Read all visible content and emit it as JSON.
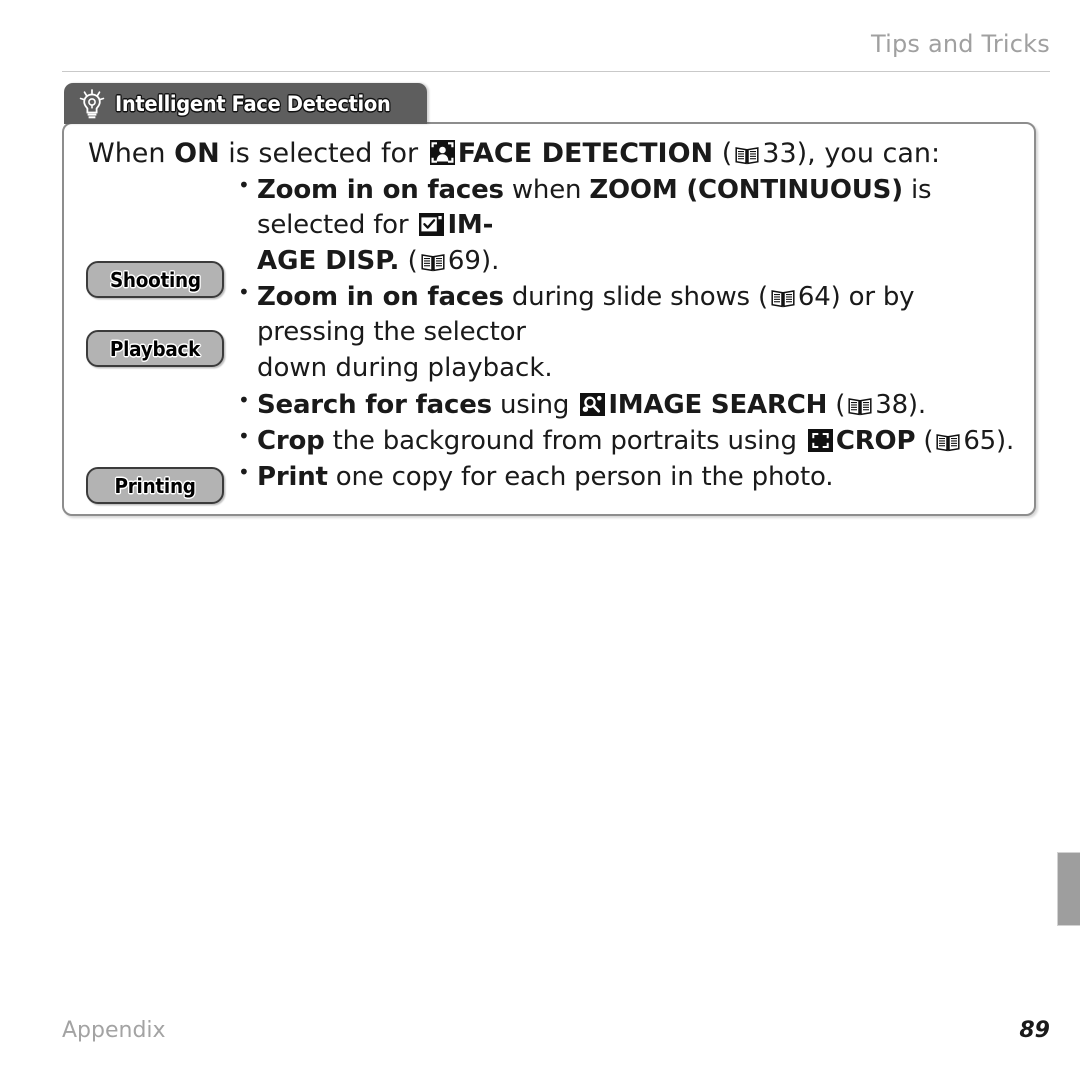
{
  "header": {
    "title": "Tips and Tricks"
  },
  "tip_box": {
    "tab_label": "Intelligent Face Detection",
    "tab_icon": "lightbulb-icon",
    "lead": {
      "part1": "When ",
      "on": "ON",
      "part2": " is selected for ",
      "icon": "face-detection-icon",
      "feature": "FACE DETECTION",
      "paren_open": " (",
      "page_icon": "book-page-ref-icon",
      "page": "33",
      "part3": "), you can:"
    },
    "badges": [
      {
        "label": "Shooting"
      },
      {
        "label": "Playback"
      },
      {
        "label": "Printing"
      }
    ],
    "bullets": [
      {
        "id": "zoom-continuous",
        "lead_bold": "Zoom in on faces",
        "mid1": " when ",
        "bold2": "ZOOM (CONTINUOUS)",
        "mid2": " is selected for ",
        "icon": "image-display-icon",
        "bold3": "IM-",
        "cont_bold": "AGE DISP.",
        "cont_paren_open": " (",
        "cont_page_icon": "book-page-ref-icon",
        "cont_page": "69",
        "cont_tail": ")."
      },
      {
        "id": "zoom-slideshow",
        "lead_bold": "Zoom in on faces",
        "mid1": " during slide shows (",
        "page_icon": "book-page-ref-icon",
        "page": "64",
        "mid2": ") or by pressing the selector",
        "cont_text": "down during playback."
      },
      {
        "id": "search-for-faces",
        "lead_bold": "Search for faces",
        "mid1": " using ",
        "icon": "image-search-icon",
        "bold2": "IMAGE SEARCH",
        "paren_open": " (",
        "page_icon": "book-page-ref-icon",
        "page": "38",
        "tail": ")."
      },
      {
        "id": "crop-background",
        "lead_bold": "Crop",
        "mid1": " the background from portraits using ",
        "icon": "crop-icon",
        "bold2": "CROP",
        "paren_open": " (",
        "page_icon": "book-page-ref-icon",
        "page": "65",
        "tail": ")."
      },
      {
        "id": "print-copies",
        "lead_bold": "Print",
        "mid1": " one copy for each person in the photo."
      }
    ]
  },
  "footer": {
    "section": "Appendix",
    "page_number": "89"
  },
  "colors": {
    "tab_background": "#5e5e5e",
    "badge_background": "#b3b3b3",
    "box_border": "#8d8d8d",
    "header_text": "#a0a0a0",
    "side_tab": "#9e9e9e"
  }
}
